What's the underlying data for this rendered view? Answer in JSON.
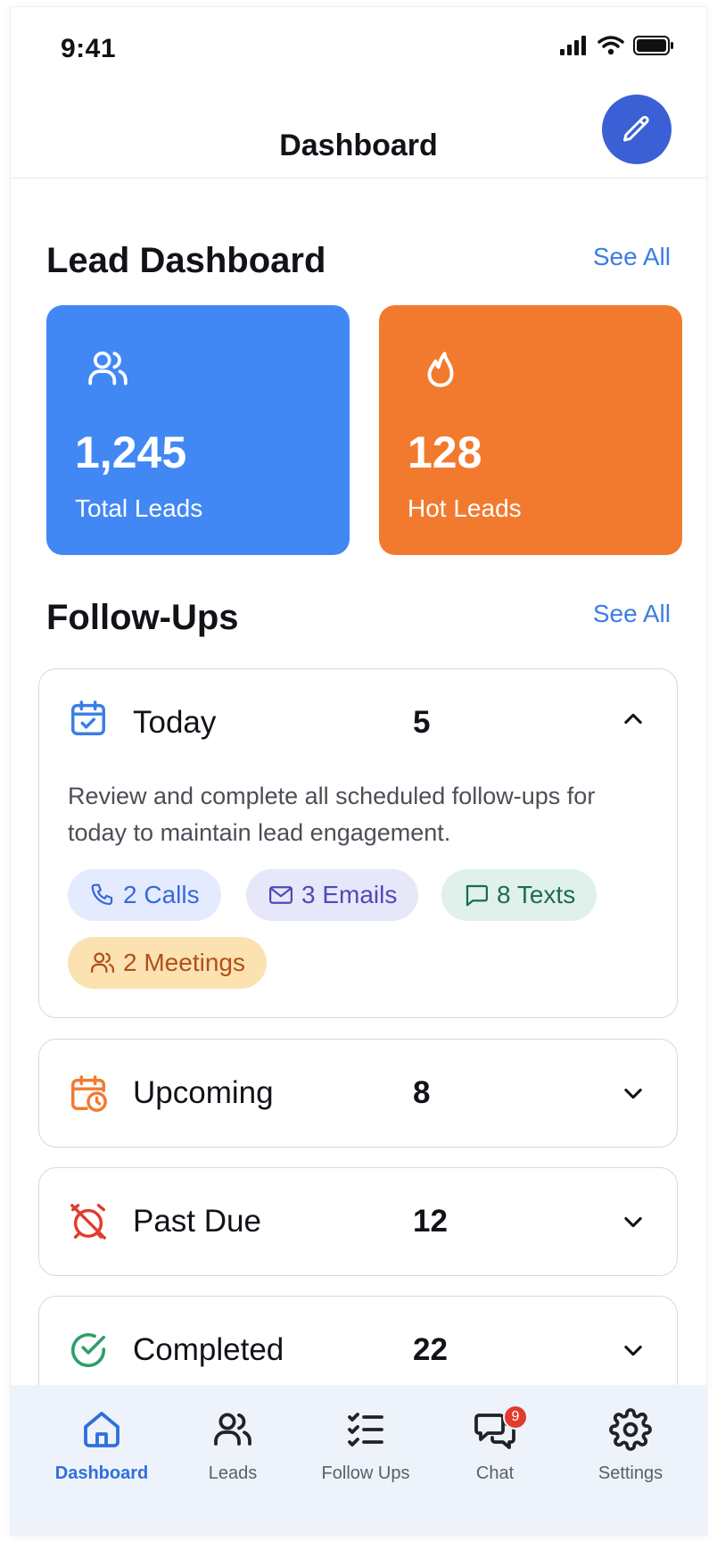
{
  "status_bar": {
    "time": "9:41"
  },
  "header": {
    "title": "Dashboard"
  },
  "lead_dashboard": {
    "title": "Lead Dashboard",
    "see_all": "See All",
    "cards": [
      {
        "value": "1,245",
        "label": "Total Leads",
        "icon": "users-icon",
        "color": "#4288f5"
      },
      {
        "value": "128",
        "label": "Hot Leads",
        "icon": "flame-icon",
        "color": "#f27a2f"
      }
    ]
  },
  "follow_ups": {
    "title": "Follow-Ups",
    "see_all": "See All",
    "items": [
      {
        "label": "Today",
        "count": "5",
        "icon": "calendar-check-icon",
        "expanded": true,
        "description": "Review and complete all scheduled follow-ups for today to maintain lead engagement.",
        "chips": [
          {
            "label": "2 Calls",
            "icon": "phone-icon"
          },
          {
            "label": "3 Emails",
            "icon": "mail-icon"
          },
          {
            "label": "8 Texts",
            "icon": "message-icon"
          },
          {
            "label": "2 Meetings",
            "icon": "users-icon"
          }
        ]
      },
      {
        "label": "Upcoming",
        "count": "8",
        "icon": "calendar-clock-icon",
        "expanded": false
      },
      {
        "label": "Past Due",
        "count": "12",
        "icon": "alarm-off-icon",
        "expanded": false
      },
      {
        "label": "Completed",
        "count": "22",
        "icon": "check-circle-icon",
        "expanded": false
      }
    ]
  },
  "bottom_nav": {
    "items": [
      {
        "label": "Dashboard",
        "icon": "home-icon",
        "active": true
      },
      {
        "label": "Leads",
        "icon": "users-icon",
        "active": false
      },
      {
        "label": "Follow Ups",
        "icon": "list-check-icon",
        "active": false
      },
      {
        "label": "Chat",
        "icon": "chat-icon",
        "active": false,
        "badge": "9"
      },
      {
        "label": "Settings",
        "icon": "gear-icon",
        "active": false
      }
    ]
  },
  "colors": {
    "accent": "#3b5fd4",
    "link": "#3a7ee6",
    "total_leads_card": "#4288f5",
    "hot_leads_card": "#f27a2f",
    "nav_active": "#2f6fdc",
    "badge": "#e23b2e"
  }
}
